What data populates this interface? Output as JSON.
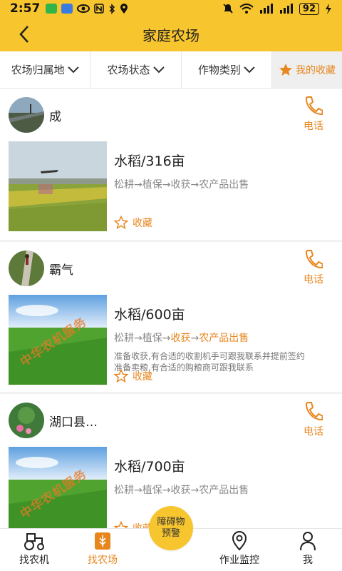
{
  "status_bar": {
    "time": "2:57",
    "battery": "92"
  },
  "header": {
    "title": "家庭农场"
  },
  "filters": [
    {
      "label": "农场归属地"
    },
    {
      "label": "农场状态"
    },
    {
      "label": "作物类别"
    },
    {
      "label": "我的收藏"
    }
  ],
  "farms": [
    {
      "owner": "成",
      "phone_label": "电话",
      "crop": "水稻/316亩",
      "steps": [
        "松耕",
        "植保",
        "收获",
        "农产品出售"
      ],
      "highlighted_steps": [],
      "notes": [],
      "collect_label": "收藏"
    },
    {
      "owner": "霸气",
      "phone_label": "电话",
      "crop": "水稻/600亩",
      "steps": [
        "松耕",
        "植保",
        "收获",
        "农产品出售"
      ],
      "highlighted_steps": [
        2,
        3
      ],
      "notes": [
        "准备收获,有合适的收割机手可跟我联系并提前签约",
        "准备卖粮,有合适的购粮商可跟我联系"
      ],
      "watermark": "中华农机服务",
      "collect_label": "收藏"
    },
    {
      "owner": "湖口县…",
      "phone_label": "电话",
      "crop": "水稻/700亩",
      "steps": [
        "松耕",
        "植保",
        "收获",
        "农产品出售"
      ],
      "highlighted_steps": [],
      "notes": [],
      "watermark": "中华农机服务",
      "collect_label": "收藏"
    }
  ],
  "tabbar": {
    "tabs": [
      {
        "label": "找农机",
        "icon": "tractor-icon"
      },
      {
        "label": "找农场",
        "icon": "farm-icon"
      },
      {
        "label": "障碍物预警",
        "icon": ""
      },
      {
        "label": "作业监控",
        "icon": "location-pin-icon"
      },
      {
        "label": "我",
        "icon": "person-icon"
      }
    ],
    "active_index": 1
  },
  "colors": {
    "accent": "#e8861e",
    "brand_yellow": "#f7c52e"
  }
}
